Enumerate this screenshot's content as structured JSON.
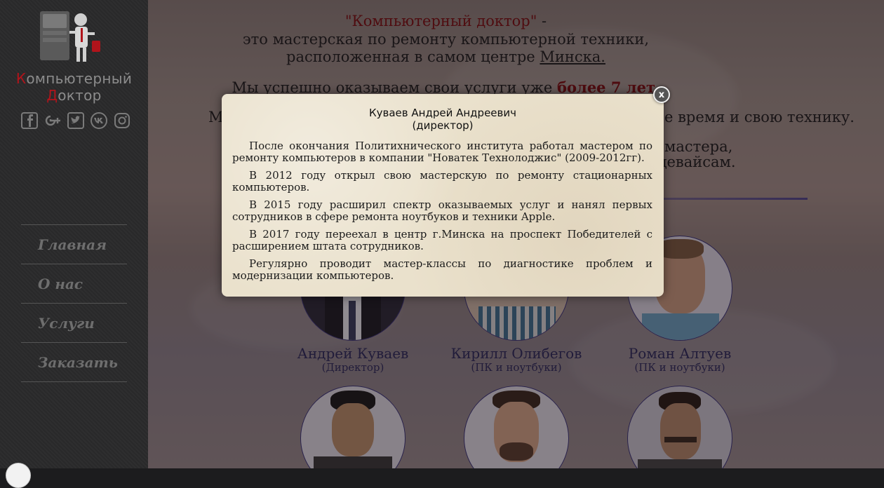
{
  "sidebar": {
    "brand": {
      "first_letter": "К",
      "line1_rest": "омпьютерный",
      "second_letter": "Д",
      "line2_rest": "октор"
    },
    "social": [
      "facebook-icon",
      "google-plus-icon",
      "twitter-icon",
      "vk-icon",
      "instagram-icon"
    ],
    "nav": [
      {
        "label": "Главная"
      },
      {
        "label": "О нас"
      },
      {
        "label": "Услуги"
      },
      {
        "label": "Заказать"
      }
    ]
  },
  "intro": {
    "company": "\"Компьютерный доктор\"",
    "dash": " -",
    "line2": "это мастерская по ремонту компьютерной техники,",
    "line3_pre": "расположенная в самом центре ",
    "city": "Минска.",
    "line4_pre": "Мы успешно оказываем свои услуги уже ",
    "years": "более 7 лет",
    "line4_post": ".",
    "line5_start": "М",
    "line5_end": "е время и свою технику.",
    "line6_end": "мастера,",
    "line7_end": "цевайсам."
  },
  "team": [
    {
      "name": "Андрей Куваев",
      "role": "(Директор)"
    },
    {
      "name": "Кирилл Олибегов",
      "role": "(ПК и ноутбуки)"
    },
    {
      "name": "Роман Алтуев",
      "role": "(ПК и ноутбуки)"
    }
  ],
  "modal": {
    "title_name": "Куваев Андрей Андреевич",
    "title_role": "(директор)",
    "paragraphs": [
      "После окончания Политихнического института работал мастером по ремонту компьютеров в компании \"Новатек Технолоджис\" (2009-2012гг).",
      "В 2012 году открыл свою мастерскую по ремонту стационарных компьютеров.",
      "В 2015 году расширил спектр оказываемых услуг и нанял первых сотрудников в сфере ремонта ноутбуков и техники Apple.",
      "В 2017 году переехал в центр г.Минска на проспект Победителей с расширением штата сотрудников.",
      "Регулярно проводит мастер-классы по диагностике проблем и модернизации компьютеров."
    ],
    "close_label": "x"
  }
}
